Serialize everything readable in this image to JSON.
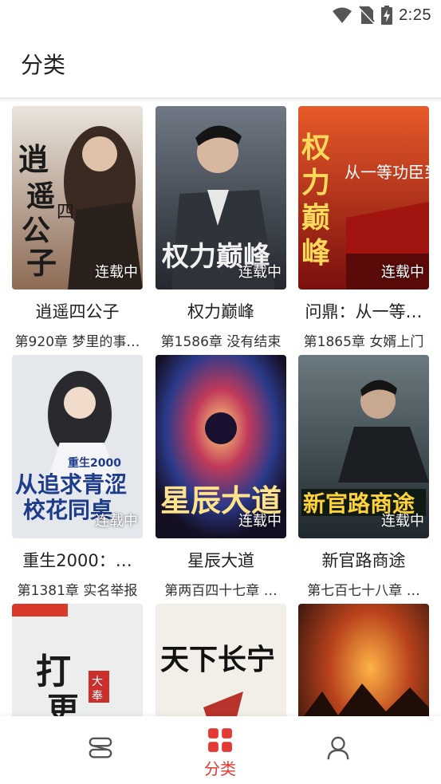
{
  "status_bar": {
    "time": "2:25",
    "icons": [
      "wifi-icon",
      "no-sim-icon",
      "battery-charging-icon"
    ]
  },
  "header": {
    "title": "分类"
  },
  "books": [
    {
      "title": "逍遥四公子",
      "chapter": "第920章 梦里的事…",
      "status": "连载中",
      "cover_text": "逍遥四公子",
      "cover_color": "#7a4a35"
    },
    {
      "title": "权力巅峰",
      "chapter": "第1586章 没有结束",
      "status": "连载中",
      "cover_text": "权力巅峰",
      "cover_color": "#3b3f48"
    },
    {
      "title": "问鼎：从一等…",
      "chapter": "第1865章 女婿上门",
      "status": "连载中",
      "cover_text": "权力巅峰",
      "cover_color": "#b51f1c"
    },
    {
      "title": "重生2000：…",
      "chapter": "第1381章 实名举报",
      "status": "连载中",
      "cover_text": "从追求青涩校花同桌开始",
      "cover_color": "#d9dde3"
    },
    {
      "title": "星辰大道",
      "chapter": "第两百四十七章 …",
      "status": "连载中",
      "cover_text": "星辰大道",
      "cover_color": "#2a1f3d"
    },
    {
      "title": "新官路商途",
      "chapter": "第七百七十八章 …",
      "status": "连载中",
      "cover_text": "新官路商途",
      "cover_color": "#2d3a3f"
    },
    {
      "title": "",
      "chapter": "",
      "status": "",
      "cover_text": "大奉打更人",
      "cover_color": "#e9eaea"
    },
    {
      "title": "",
      "chapter": "",
      "status": "",
      "cover_text": "天下长宁",
      "cover_color": "#f2eee8"
    },
    {
      "title": "",
      "chapter": "",
      "status": "",
      "cover_text": "",
      "cover_color": "#6b2a18"
    }
  ],
  "bottom_nav": {
    "items": [
      {
        "label": "",
        "icon": "bookshelf-icon"
      },
      {
        "label": "分类",
        "icon": "category-grid-icon",
        "active": true
      },
      {
        "label": "",
        "icon": "profile-icon"
      }
    ]
  },
  "colors": {
    "accent": "#e53935"
  }
}
